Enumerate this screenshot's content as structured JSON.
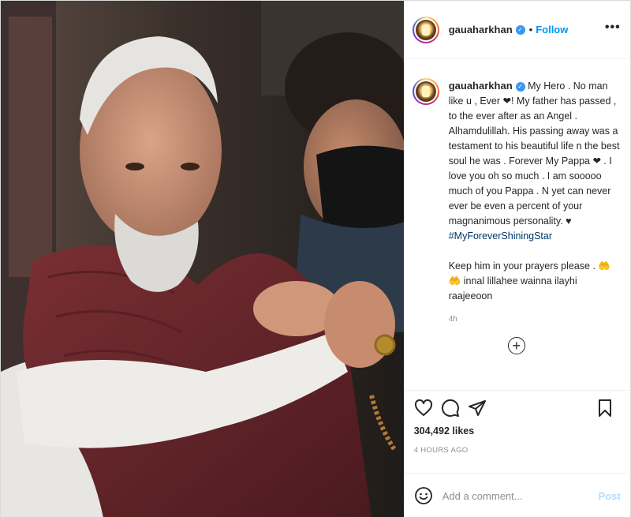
{
  "header": {
    "username": "gauaharkhan",
    "separator": "•",
    "follow_label": "Follow",
    "more_label": "•••"
  },
  "caption": {
    "username": "gauaharkhan",
    "paragraph1": "My Hero . No man like u , Ever ❤! My father has passed , to the ever after as an Angel . Alhamdulillah. His passing away was a testament to his beautiful life n the best soul he was . Forever My Pappa ❤ . I love you oh so much . I am sooooo much of you Pappa . N yet can never ever be even a percent of your magnanimous personality. ♥",
    "hashtag": "#MyForeverShiningStar",
    "paragraph2": "Keep him in your prayers please . 🤲🤲 innal lillahee wainna ilayhi raajeeoon",
    "time_ago": "4h"
  },
  "load_more_label": "+",
  "actions": {
    "likes": "304,492 likes",
    "posted": "4 HOURS AGO"
  },
  "comment": {
    "placeholder": "Add a comment...",
    "post_label": "Post"
  },
  "colors": {
    "link_blue": "#0095f6",
    "verified_blue": "#3897f0",
    "muted_text": "#8e8e8e",
    "post_disabled": "#b3dbff"
  },
  "icons": {
    "like": "heart-icon",
    "comment": "comment-icon",
    "share": "paper-plane-icon",
    "save": "bookmark-icon",
    "emoji": "smiley-icon",
    "verified": "verified-badge-icon",
    "more": "more-options-icon",
    "load_more": "plus-circle-icon"
  }
}
